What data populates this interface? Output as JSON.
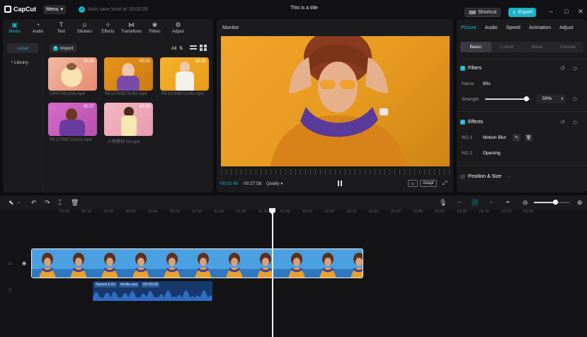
{
  "app": {
    "name": "CapCut",
    "menu_label": "Menu",
    "autosave_text": "Auto save local at 16:00:29",
    "doc_title": "This is a title",
    "shortcut_label": "Shortcut",
    "export_label": "Export"
  },
  "tools": [
    {
      "label": "Media",
      "icon": "media-icon",
      "active": true
    },
    {
      "label": "Audio",
      "icon": "audio-icon"
    },
    {
      "label": "Text",
      "icon": "text-icon"
    },
    {
      "label": "Stickers",
      "icon": "stickers-icon"
    },
    {
      "label": "Effects",
      "icon": "effects-icon"
    },
    {
      "label": "Transitions",
      "icon": "transitions-icon"
    },
    {
      "label": "Filters",
      "icon": "filters-icon"
    },
    {
      "label": "Adjust",
      "icon": "adjust-icon"
    }
  ],
  "media_nav": [
    {
      "label": "Local",
      "active": true
    },
    {
      "label": "• Library"
    }
  ],
  "media": {
    "import_label": "Import",
    "filter_label": "All",
    "items": [
      {
        "name": "CNST061334.mp4",
        "duration": "00:30"
      },
      {
        "name": "RE1278387214l2.mp4",
        "duration": "00:32"
      },
      {
        "name": "RE1278387214l2.mp4",
        "duration": "00:30"
      },
      {
        "name": "RE1278l8721412.mp4",
        "duration": "00:27"
      },
      {
        "name": "人物素材 04.mp4",
        "duration": "00:28"
      }
    ]
  },
  "monitor": {
    "title": "Monitor",
    "current_time": "00:02:45",
    "total_time": "00:27:58",
    "quality_label": "Quality ▾",
    "fit_label": "Adapt"
  },
  "properties": {
    "tabs": [
      {
        "label": "Picture",
        "active": true
      },
      {
        "label": "Audio"
      },
      {
        "label": "Speed"
      },
      {
        "label": "Animation"
      },
      {
        "label": "Adjust"
      }
    ],
    "subtabs": [
      {
        "label": "Basic",
        "active": true
      },
      {
        "label": "Cutout"
      },
      {
        "label": "Mask"
      },
      {
        "label": "Canvas"
      }
    ],
    "filters": {
      "title": "Filters",
      "name_label": "Name",
      "name_value": "90s",
      "strength_label": "Strength",
      "strength_value": "50%",
      "strength_fraction": 0.5
    },
    "effects": {
      "title": "Effects",
      "no1_label": "NO 1",
      "no1_value": "Motion Blur",
      "no2_label": "NO 2",
      "no2_value": "Opening"
    },
    "position_title": "Position & Size"
  },
  "timeline": {
    "ruler": [
      "00:00",
      "00:10",
      "00:20",
      "00:30",
      "00:40",
      "00:50",
      "01:00",
      "01:10",
      "01:20",
      "01:30",
      "01:40",
      "01:50",
      "02:00",
      "02:10",
      "02:20",
      "02:30",
      "02:40",
      "02:50",
      "03:00",
      "03:10",
      "03:20",
      "03:30"
    ],
    "audio_labels": [
      "Speed 2.0x",
      "Audio.aac",
      "00:00:00"
    ],
    "zoom_fraction": 0.6
  }
}
